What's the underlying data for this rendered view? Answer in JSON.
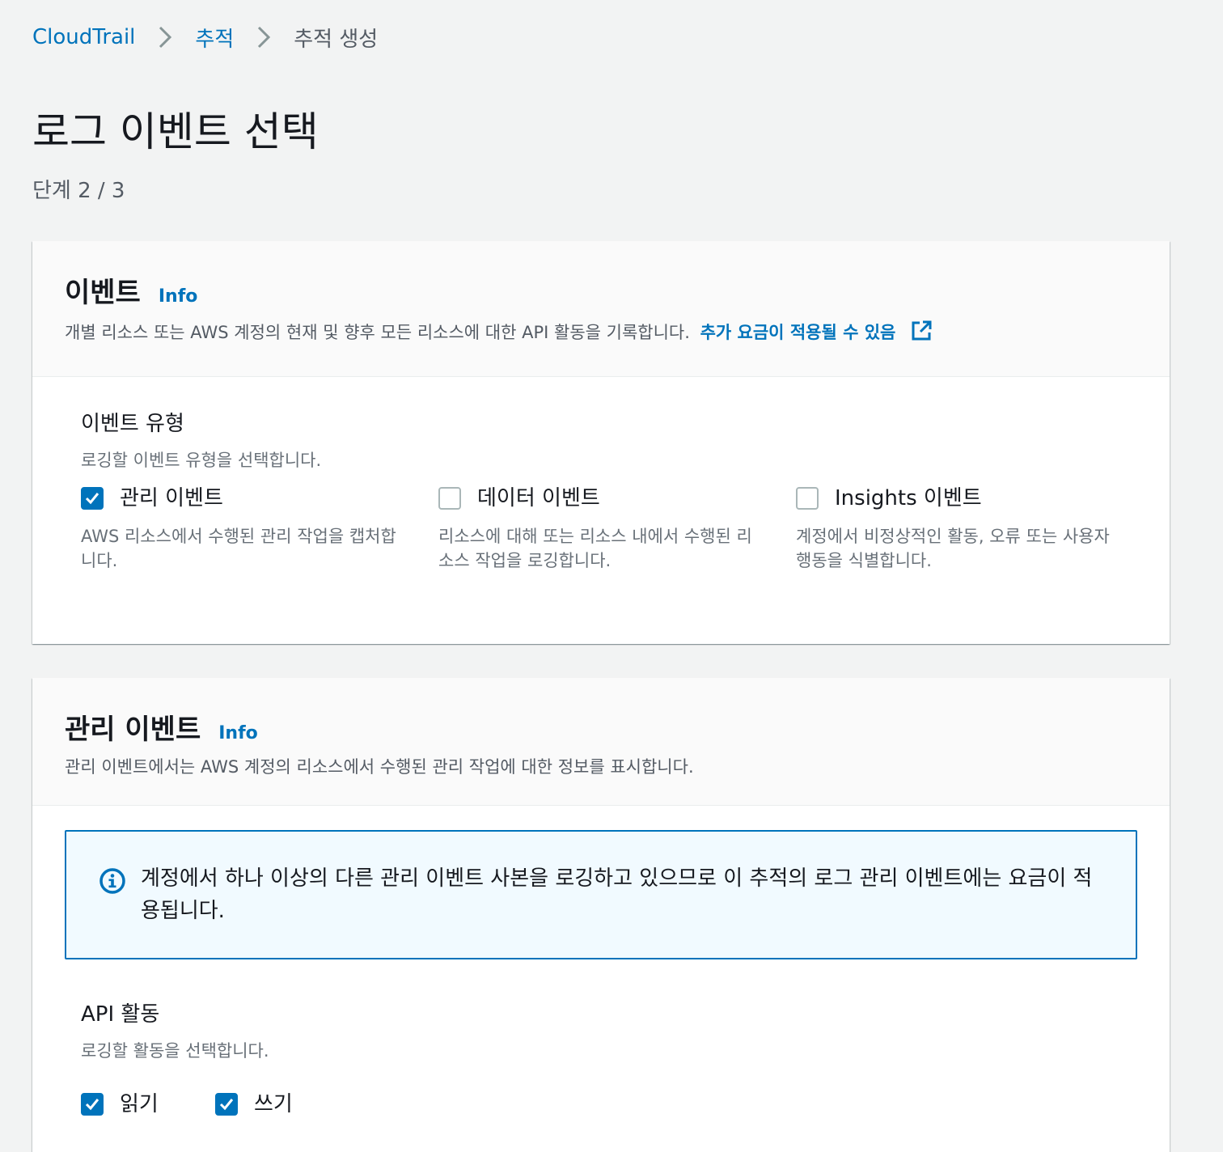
{
  "breadcrumb": {
    "items": [
      {
        "label": "CloudTrail"
      },
      {
        "label": "추적"
      },
      {
        "label": "추적 생성"
      }
    ]
  },
  "page": {
    "title": "로그 이벤트 선택",
    "step": "단계 2 / 3"
  },
  "events_panel": {
    "title": "이벤트",
    "info": "Info",
    "description": "개별 리소스 또는 AWS 계정의 현재 및 향후 모든 리소스에 대한 API 활동을 기록합니다.",
    "link": "추가 요금이 적용될 수 있음",
    "event_type": {
      "label": "이벤트 유형",
      "description": "로깅할 이벤트 유형을 선택합니다.",
      "options": [
        {
          "label": "관리 이벤트",
          "checked": true,
          "description": "AWS 리소스에서 수행된 관리 작업을 캡처합니다."
        },
        {
          "label": "데이터 이벤트",
          "checked": false,
          "description": "리소스에 대해 또는 리소스 내에서 수행된 리소스 작업을 로깅합니다."
        },
        {
          "label": "Insights 이벤트",
          "checked": false,
          "description": "계정에서 비정상적인 활동, 오류 또는 사용자 행동을 식별합니다."
        }
      ]
    }
  },
  "management_panel": {
    "title": "관리 이벤트",
    "info": "Info",
    "description": "관리 이벤트에서는 AWS 계정의 리소스에서 수행된 관리 작업에 대한 정보를 표시합니다.",
    "alert": "계정에서 하나 이상의 다른 관리 이벤트 사본을 로깅하고 있으므로 이 추적의 로그 관리 이벤트에는 요금이 적용됩니다.",
    "api_activity": {
      "label": "API 활동",
      "description": "로깅할 활동을 선택합니다.",
      "options": [
        {
          "label": "읽기",
          "checked": true
        },
        {
          "label": "쓰기",
          "checked": true
        }
      ]
    }
  },
  "colors": {
    "link": "#0073bb",
    "background": "#f2f3f3",
    "panel": "#ffffff",
    "alert_bg": "#f1faff"
  }
}
